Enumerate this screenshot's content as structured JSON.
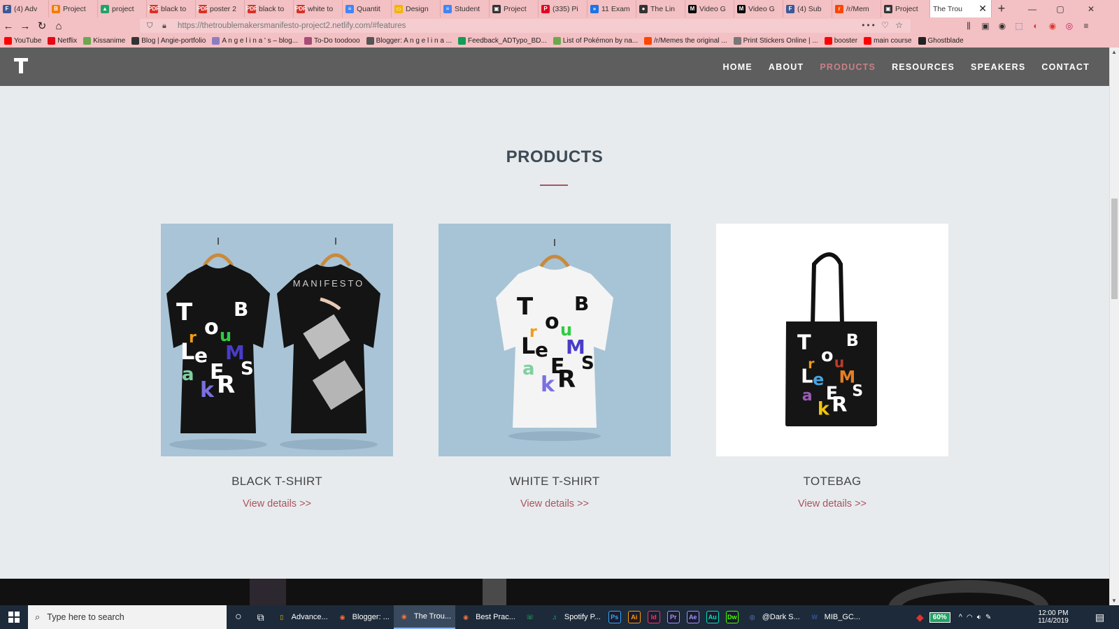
{
  "browser": {
    "tabs": [
      {
        "label": "(4) Adv",
        "fav": "F",
        "color": "#3b5998"
      },
      {
        "label": "Project",
        "fav": "B",
        "color": "#f57d00"
      },
      {
        "label": "project",
        "fav": "▲",
        "color": "#1fa463"
      },
      {
        "label": "black to",
        "fav": "PDF",
        "color": "#d93025"
      },
      {
        "label": "poster 2",
        "fav": "PDF",
        "color": "#d93025"
      },
      {
        "label": "black to",
        "fav": "PDF",
        "color": "#d93025"
      },
      {
        "label": "white to",
        "fav": "PDF",
        "color": "#d93025"
      },
      {
        "label": "Quantit",
        "fav": "≡",
        "color": "#4285f4"
      },
      {
        "label": "Design",
        "fav": "▭",
        "color": "#f4b400"
      },
      {
        "label": "Student",
        "fav": "≡",
        "color": "#4285f4"
      },
      {
        "label": "Project",
        "fav": "▣",
        "color": "#333333"
      },
      {
        "label": "(335) Pi",
        "fav": "P",
        "color": "#e60023"
      },
      {
        "label": "11 Exam",
        "fav": "»",
        "color": "#1a73e8"
      },
      {
        "label": "The Lin",
        "fav": "●",
        "color": "#333333"
      },
      {
        "label": "Video G",
        "fav": "M",
        "color": "#000000"
      },
      {
        "label": "Video G",
        "fav": "M",
        "color": "#000000"
      },
      {
        "label": "(4) Sub",
        "fav": "F",
        "color": "#3b5998"
      },
      {
        "label": "/r/Mem",
        "fav": "r",
        "color": "#ff4500"
      },
      {
        "label": "Project",
        "fav": "▣",
        "color": "#333333"
      }
    ],
    "active_tab": {
      "label": "The Trou",
      "close": "✕"
    },
    "new_tab": "+",
    "window": {
      "minimize": "—",
      "maximize": "▢",
      "close": "✕"
    },
    "nav": {
      "back": "←",
      "forward": "→",
      "reload": "↻",
      "home": "⌂"
    },
    "url": "https://thetroublemakersmanifesto-project2.netlify.com/#features",
    "url_actions": "••• ♡ ☆",
    "toolbar_icons": [
      "library-icon",
      "sidebar-icon",
      "account-icon",
      "extension-icon",
      "pocket-icon",
      "opera-icon",
      "vpn-icon",
      "menu-icon"
    ],
    "bookmarks": [
      {
        "label": "YouTube",
        "color": "#ff0000"
      },
      {
        "label": "Netflix",
        "color": "#e50914"
      },
      {
        "label": "Kissanime",
        "color": "#6aa84f"
      },
      {
        "label": "Blog | Angie-portfolio",
        "color": "#333333"
      },
      {
        "label": "A n g e l i n a ' s – blog...",
        "color": "#8e7cc3"
      },
      {
        "label": "To-Do toodooo",
        "color": "#a64d79"
      },
      {
        "label": "Blogger: A n g e l i n a ...",
        "color": "#555555"
      },
      {
        "label": "Feedback_ADTypo_BD...",
        "color": "#0f9d58"
      },
      {
        "label": "List of Pokémon by na...",
        "color": "#6aa84f"
      },
      {
        "label": "/r/Memes the original ...",
        "color": "#ff4500"
      },
      {
        "label": "Print Stickers Online | ...",
        "color": "#777777"
      },
      {
        "label": "booster",
        "color": "#ff0000"
      },
      {
        "label": "main course",
        "color": "#ff0000"
      },
      {
        "label": "Ghostblade",
        "color": "#222222"
      }
    ]
  },
  "site": {
    "logo": "T",
    "nav": [
      {
        "label": "HOME",
        "active": false
      },
      {
        "label": "ABOUT",
        "active": false
      },
      {
        "label": "PRODUCTS",
        "active": true
      },
      {
        "label": "RESOURCES",
        "active": false
      },
      {
        "label": "SPEAKERS",
        "active": false
      },
      {
        "label": "CONTACT",
        "active": false
      }
    ],
    "section_title": "PRODUCTS",
    "products": [
      {
        "title": "BLACK T-SHIRT",
        "link": "View details >>",
        "image": "black-tshirt-front-back",
        "back_print": "MANIFESTO"
      },
      {
        "title": "WHITE T-SHIRT",
        "link": "View details >>",
        "image": "white-tshirt"
      },
      {
        "title": "TOTEBAG",
        "link": "View details >>",
        "image": "black-totebag"
      }
    ],
    "print_letters": [
      {
        "ch": "T",
        "c": "#ffffff"
      },
      {
        "ch": "r",
        "c": "#f39c12"
      },
      {
        "ch": "o",
        "c": "#ffffff"
      },
      {
        "ch": "u",
        "c": "#2ecc40"
      },
      {
        "ch": "B",
        "c": "#ffffff"
      },
      {
        "ch": "L",
        "c": "#ffffff"
      },
      {
        "ch": "e",
        "c": "#ffffff"
      },
      {
        "ch": "M",
        "c": "#4a3cc9"
      },
      {
        "ch": "a",
        "c": "#7fd0a0"
      },
      {
        "ch": "E",
        "c": "#ffffff"
      },
      {
        "ch": "S",
        "c": "#ffffff"
      },
      {
        "ch": "k",
        "c": "#7a70e0"
      },
      {
        "ch": "R",
        "c": "#ffffff"
      }
    ],
    "print_letters_white": [
      {
        "ch": "T",
        "c": "#111111"
      },
      {
        "ch": "r",
        "c": "#f39c12"
      },
      {
        "ch": "o",
        "c": "#111111"
      },
      {
        "ch": "u",
        "c": "#2ecc40"
      },
      {
        "ch": "B",
        "c": "#111111"
      },
      {
        "ch": "L",
        "c": "#111111"
      },
      {
        "ch": "e",
        "c": "#111111"
      },
      {
        "ch": "M",
        "c": "#4a3cc9"
      },
      {
        "ch": "a",
        "c": "#7fd0a0"
      },
      {
        "ch": "E",
        "c": "#111111"
      },
      {
        "ch": "S",
        "c": "#111111"
      },
      {
        "ch": "k",
        "c": "#7a70e0"
      },
      {
        "ch": "R",
        "c": "#111111"
      }
    ],
    "print_letters_tote": [
      {
        "ch": "T",
        "c": "#ffffff"
      },
      {
        "ch": "r",
        "c": "#f39c12"
      },
      {
        "ch": "o",
        "c": "#ffffff"
      },
      {
        "ch": "u",
        "c": "#c0392b"
      },
      {
        "ch": "B",
        "c": "#ffffff"
      },
      {
        "ch": "L",
        "c": "#ffffff"
      },
      {
        "ch": "e",
        "c": "#4aa3df"
      },
      {
        "ch": "M",
        "c": "#e67e22"
      },
      {
        "ch": "a",
        "c": "#9b59b6"
      },
      {
        "ch": "E",
        "c": "#ffffff"
      },
      {
        "ch": "S",
        "c": "#ffffff"
      },
      {
        "ch": "k",
        "c": "#f1c40f"
      },
      {
        "ch": "R",
        "c": "#ffffff"
      }
    ],
    "accent": "#a8555d",
    "nav_active_color": "#c98087",
    "header_bg": "#5e5e5e",
    "page_bg": "#e8ebee"
  },
  "taskbar": {
    "search_placeholder": "Type here to search",
    "apps": [
      {
        "label": "Advance...",
        "ico": "▯",
        "color": "#f4b400",
        "active": false
      },
      {
        "label": "Blogger: ...",
        "ico": "◉",
        "color": "#ff7139",
        "active": false
      },
      {
        "label": "The Trou...",
        "ico": "◉",
        "color": "#ff7139",
        "active": true
      },
      {
        "label": "Best Prac...",
        "ico": "◉",
        "color": "#ff7139",
        "active": false
      }
    ],
    "pinned": [
      {
        "ico": "☏",
        "color": "#25d366"
      },
      {
        "ico": "♫",
        "color": "#1db954"
      }
    ],
    "spotify_label": "Spotify P...",
    "adobe": [
      {
        "ico": "Ps",
        "color": "#31a8ff"
      },
      {
        "ico": "Ai",
        "color": "#ff9a00"
      },
      {
        "ico": "Id",
        "color": "#ff3366"
      },
      {
        "ico": "Pr",
        "color": "#9999ff"
      },
      {
        "ico": "Ae",
        "color": "#9999ff"
      },
      {
        "ico": "Au",
        "color": "#00e4bb"
      },
      {
        "ico": "Dw",
        "color": "#4aff00"
      }
    ],
    "more_apps": [
      {
        "label": "@Dark S...",
        "ico": "◎",
        "color": "#7289da"
      },
      {
        "label": "MIB_GC...",
        "ico": "W",
        "color": "#2b579a"
      }
    ],
    "battery": "60%",
    "time": "12:00 PM",
    "date": "11/4/2019"
  }
}
